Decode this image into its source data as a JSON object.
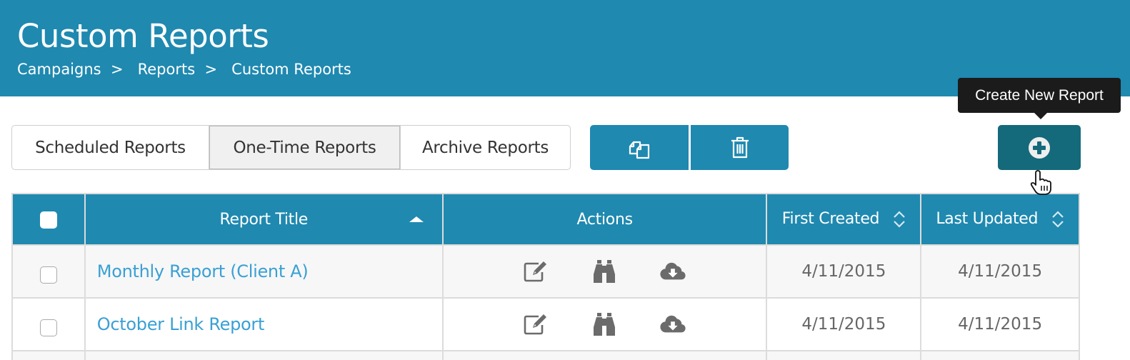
{
  "header": {
    "title": "Custom Reports",
    "breadcrumb": [
      "Campaigns",
      "Reports",
      "Custom Reports"
    ],
    "separator": ">"
  },
  "tabs": [
    {
      "label": "Scheduled Reports",
      "active": false
    },
    {
      "label": "One-Time Reports",
      "active": true
    },
    {
      "label": "Archive Reports",
      "active": false
    }
  ],
  "toolbar": {
    "copy_icon": "copy-icon",
    "delete_icon": "trash-icon",
    "create_icon": "plus-circle-icon",
    "create_tooltip": "Create New Report"
  },
  "table": {
    "columns": [
      "Report Title",
      "Actions",
      "First Created",
      "Last Updated"
    ],
    "rows": [
      {
        "title": "Monthly Report (Client A)",
        "first_created": "4/11/2015",
        "last_updated": "4/11/2015",
        "actions": [
          "edit-icon",
          "binoculars-icon",
          "cloud-download-icon"
        ]
      },
      {
        "title": "October Link Report",
        "first_created": "4/11/2015",
        "last_updated": "4/11/2015",
        "actions": [
          "edit-icon",
          "binoculars-icon",
          "cloud-download-icon"
        ]
      }
    ]
  },
  "colors": {
    "brand": "#1f89b0",
    "create_button": "#146a7a",
    "link": "#3aa0d4",
    "icon": "#6b6b6b"
  }
}
